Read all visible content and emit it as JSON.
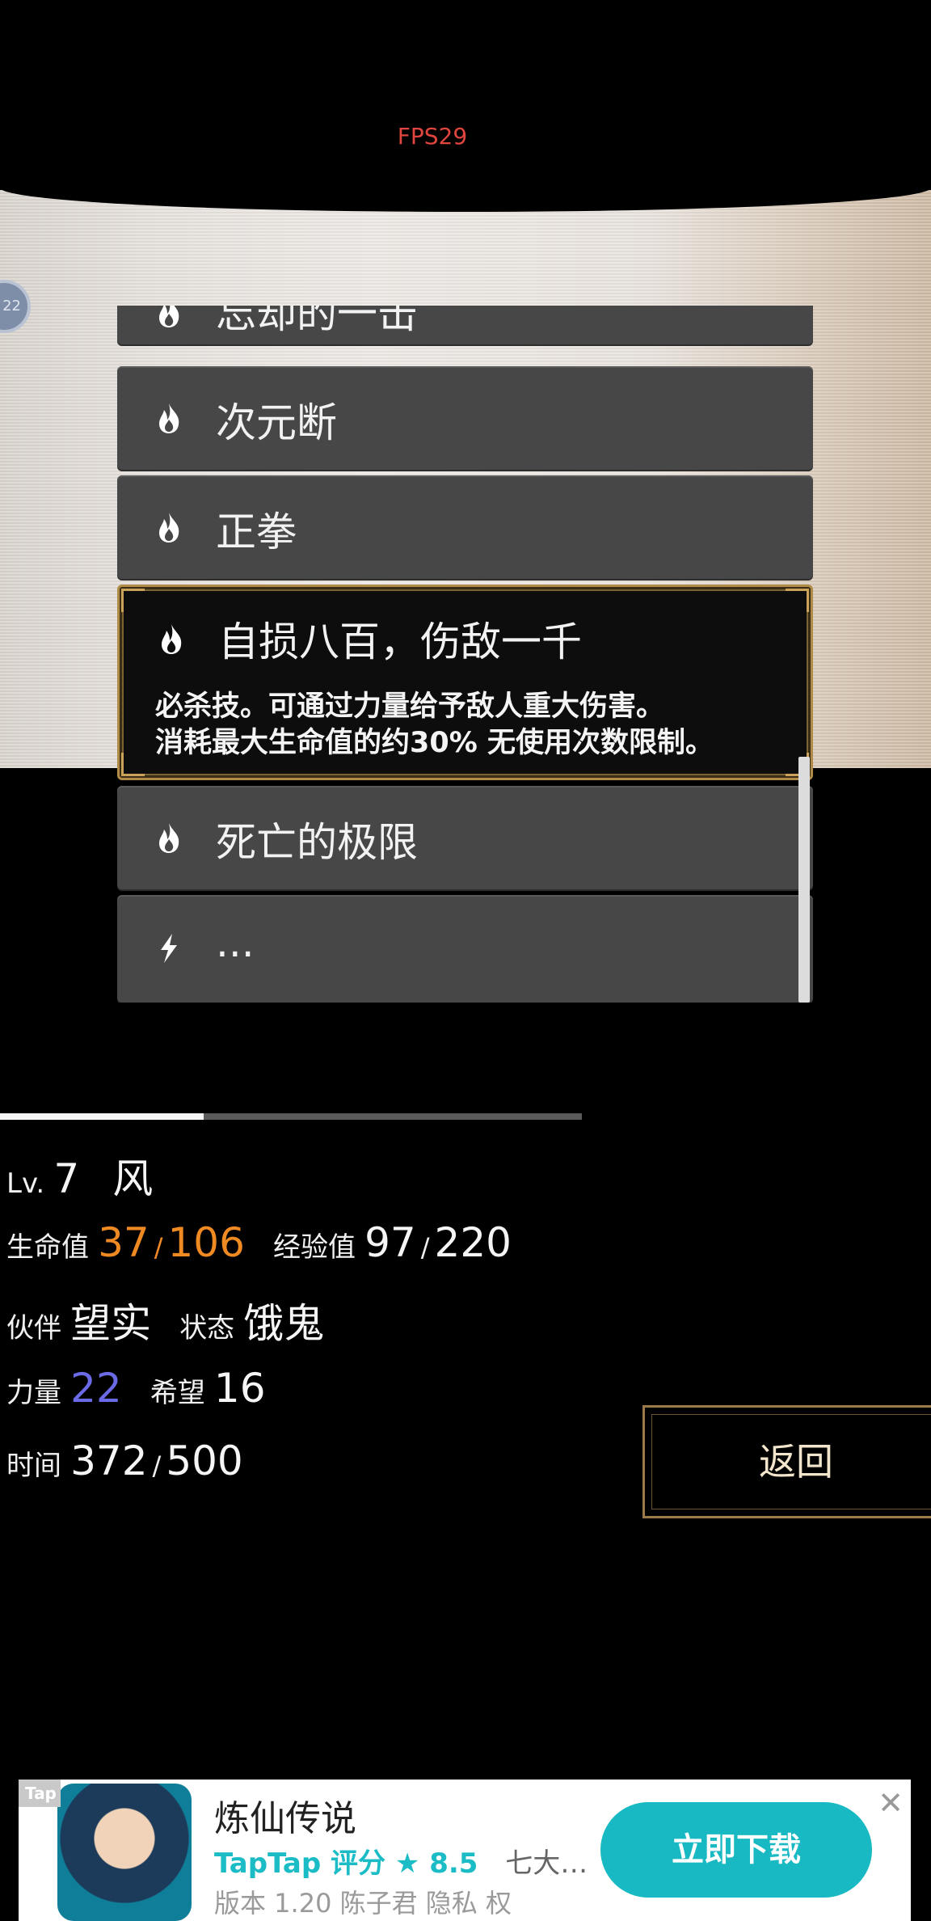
{
  "fps": "FPS29",
  "badge_text": "22",
  "skills": [
    {
      "name": "忘却的一击",
      "icon": "flame-icon"
    },
    {
      "name": "次元断",
      "icon": "flame-icon"
    },
    {
      "name": "正拳",
      "icon": "flame-icon"
    },
    {
      "name": "自损八百，伤敌一千",
      "icon": "flame-icon",
      "selected": true,
      "desc_line1": "必杀技。可通过力量给予敌人重大伤害。",
      "desc_line2": "消耗最大生命值的约30% 无使用次数限制。"
    },
    {
      "name": "死亡的极限",
      "icon": "flame-icon"
    },
    {
      "name": "...",
      "icon": "lightning-icon"
    }
  ],
  "progress": 0.35,
  "stats": {
    "lv_label": "Lv.",
    "lv_value": "7",
    "element": "风",
    "hp_label": "生命值",
    "hp_current": "37",
    "hp_max": "106",
    "exp_label": "经验值",
    "exp_current": "97",
    "exp_max": "220",
    "partner_label": "伙伴",
    "partner_value": "望实",
    "status_label": "状态",
    "status_value": "饿鬼",
    "power_label": "力量",
    "power_value": "22",
    "hope_label": "希望",
    "hope_value": "16",
    "time_label": "时间",
    "time_current": "372",
    "time_max": "500",
    "slash": "/"
  },
  "back_label": "返回",
  "ad": {
    "tag": "Tap",
    "title": "炼仙传说",
    "rating_prefix": "TapTap 评分",
    "rating_star": "★",
    "rating_value": "8.5",
    "rating_extra": "七大…",
    "version_line": "版本 1.20  陈子君  隐私  权",
    "download": "立即下载",
    "close": "✕"
  },
  "colors": {
    "accent_orange": "#ef8a23",
    "accent_purple": "#6a6ae6",
    "ad_teal": "#19b9c3",
    "gold_border": "#b08b48"
  }
}
